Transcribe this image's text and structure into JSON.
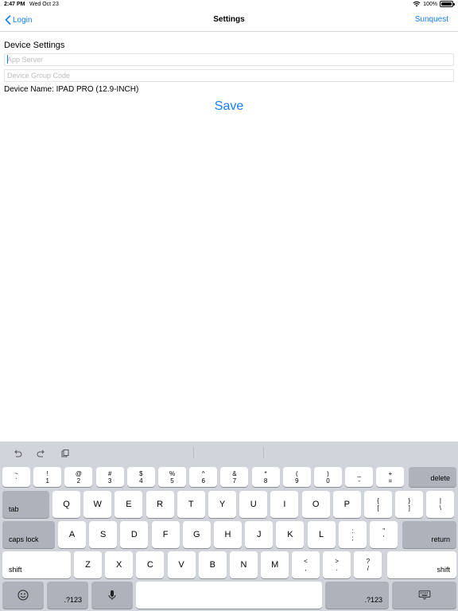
{
  "status_bar": {
    "time": "2:47 PM",
    "date": "Wed Oct 23",
    "battery": "100%"
  },
  "nav": {
    "back_label": "Login",
    "title": "Settings",
    "right_label": "Sunquest"
  },
  "form": {
    "section_title": "Device Settings",
    "app_server_placeholder": "App Server",
    "app_server_value": "",
    "group_code_placeholder": "Device Group Code",
    "group_code_value": "",
    "device_name": "Device Name: IPAD PRO (12.9-INCH)",
    "save_label": "Save"
  },
  "keyboard": {
    "shortcuts": [
      "undo-icon",
      "redo-icon",
      "paste-icon"
    ],
    "row1": [
      {
        "top": "~",
        "bottom": "`"
      },
      {
        "top": "!",
        "bottom": "1"
      },
      {
        "top": "@",
        "bottom": "2"
      },
      {
        "top": "#",
        "bottom": "3"
      },
      {
        "top": "$",
        "bottom": "4"
      },
      {
        "top": "%",
        "bottom": "5"
      },
      {
        "top": "^",
        "bottom": "6"
      },
      {
        "top": "&",
        "bottom": "7"
      },
      {
        "top": "*",
        "bottom": "8"
      },
      {
        "top": "(",
        "bottom": "9"
      },
      {
        "top": ")",
        "bottom": "0"
      },
      {
        "top": "_",
        "bottom": "-"
      },
      {
        "top": "+",
        "bottom": "="
      }
    ],
    "delete_label": "delete",
    "tab_label": "tab",
    "row2": [
      "Q",
      "W",
      "E",
      "R",
      "T",
      "Y",
      "U",
      "I",
      "O",
      "P"
    ],
    "row2_extra": [
      {
        "top": "{",
        "bottom": "["
      },
      {
        "top": "}",
        "bottom": "]"
      },
      {
        "top": "|",
        "bottom": "\\"
      }
    ],
    "caps_label": "caps lock",
    "row3": [
      "A",
      "S",
      "D",
      "F",
      "G",
      "H",
      "J",
      "K",
      "L"
    ],
    "row3_extra": [
      {
        "top": ":",
        "bottom": ";"
      },
      {
        "top": "\"",
        "bottom": "'"
      }
    ],
    "return_label": "return",
    "shift_label": "shift",
    "row4": [
      "Z",
      "X",
      "C",
      "V",
      "B",
      "N",
      "M"
    ],
    "row4_extra": [
      {
        "top": "<",
        "bottom": ","
      },
      {
        "top": ">",
        "bottom": "."
      },
      {
        "top": "?",
        "bottom": "/"
      }
    ],
    "numbers_label": ".?123"
  }
}
